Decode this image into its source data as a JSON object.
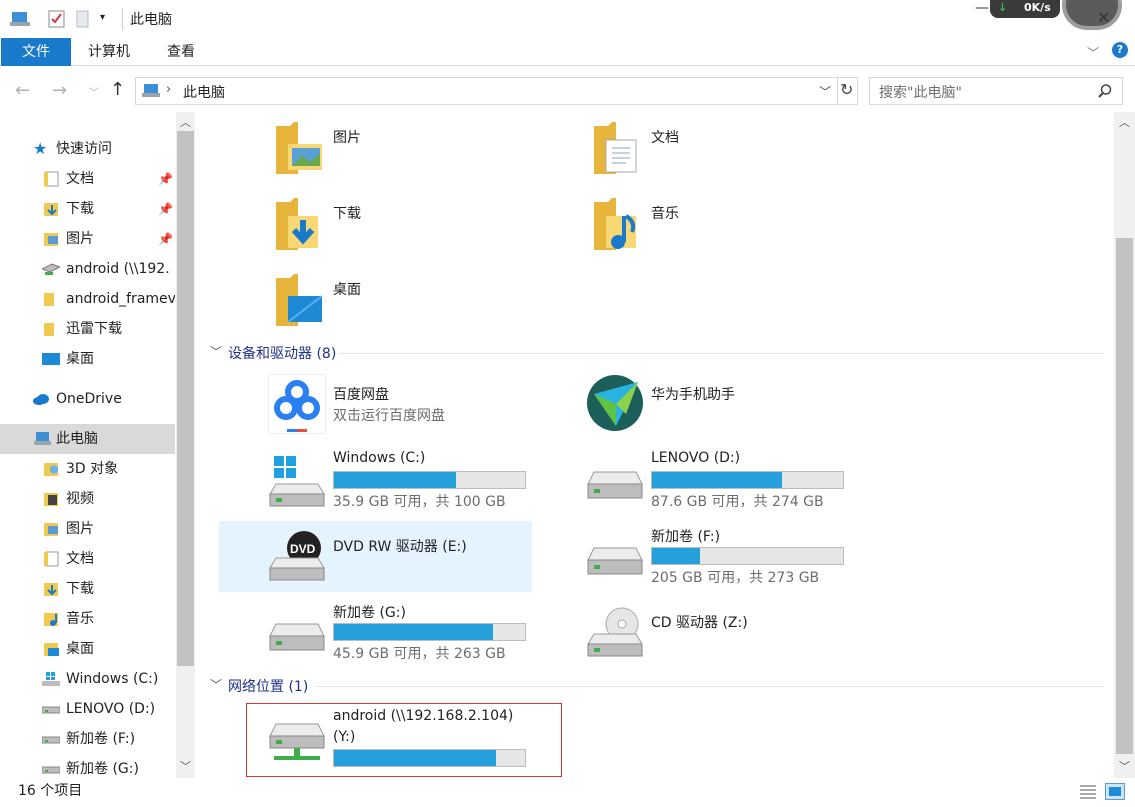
{
  "window": {
    "title": "此电脑",
    "speed": "0K/s"
  },
  "ribbon": {
    "tabs": [
      "文件",
      "计算机",
      "查看"
    ]
  },
  "address": {
    "location": "此电脑",
    "search_placeholder": "搜索\"此电脑\""
  },
  "sidebar": {
    "quick_access": "快速访问",
    "quick_items": [
      "文档",
      "下载",
      "图片",
      "android (\\\\192.",
      "android_framev",
      "迅雷下载",
      "桌面"
    ],
    "onedrive": "OneDrive",
    "this_pc": "此电脑",
    "pc_items": [
      "3D 对象",
      "视频",
      "图片",
      "文档",
      "下载",
      "音乐",
      "桌面",
      "Windows (C:)",
      "LENOVO (D:)",
      "新加卷 (F:)",
      "新加卷 (G:)"
    ]
  },
  "folders": [
    "图片",
    "文档",
    "下载",
    "音乐",
    "桌面"
  ],
  "groups": {
    "devices": "设备和驱动器 (8)",
    "network": "网络位置 (1)"
  },
  "devices": {
    "baidu": {
      "name": "百度网盘",
      "sub": "双击运行百度网盘"
    },
    "huawei": {
      "name": "华为手机助手"
    },
    "c": {
      "name": "Windows (C:)",
      "sub": "35.9 GB 可用，共 100 GB",
      "used": 0.64
    },
    "d": {
      "name": "LENOVO (D:)",
      "sub": "87.6 GB 可用，共 274 GB",
      "used": 0.68
    },
    "e": {
      "name": "DVD RW 驱动器 (E:)",
      "label": "DVD"
    },
    "f": {
      "name": "新加卷 (F:)",
      "sub": "205 GB 可用，共 273 GB",
      "used": 0.25
    },
    "g": {
      "name": "新加卷 (G:)",
      "sub": "45.9 GB 可用，共 263 GB",
      "used": 0.83
    },
    "z": {
      "name": "CD 驱动器 (Z:)"
    }
  },
  "network": {
    "name_line1": "android (\\\\192.168.2.104)",
    "name_line2": "(Y:)",
    "used": 0.85
  },
  "status": {
    "count": "16 个项目"
  },
  "colors": {
    "accent": "#1979ca",
    "bar_fill": "#26a0da",
    "selection": "#e5f3ff",
    "highlight_border": "#d33a3a"
  }
}
